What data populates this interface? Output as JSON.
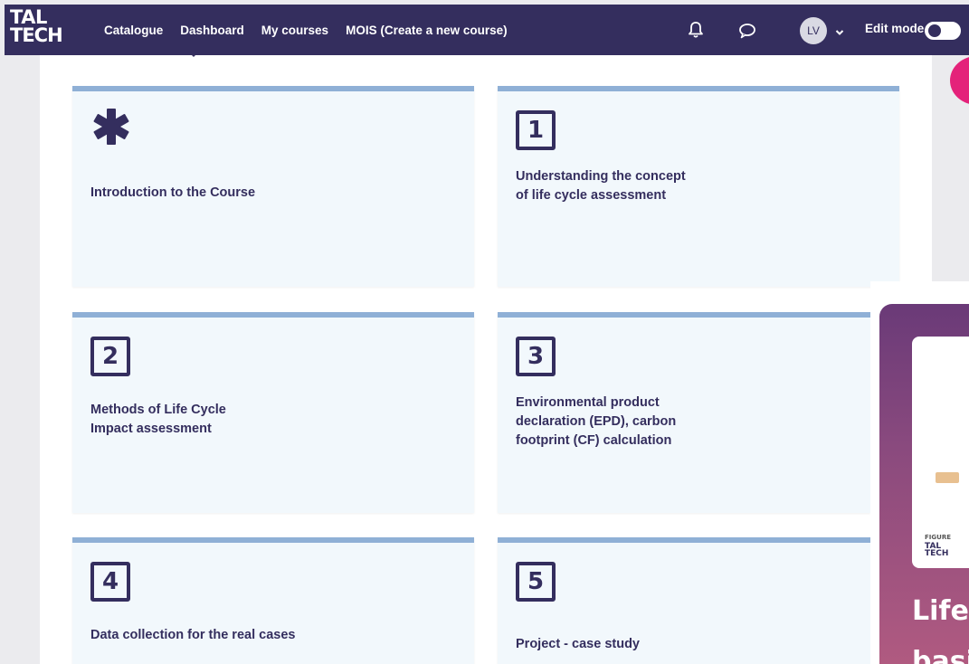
{
  "navbar": {
    "logo_line1": "TAL",
    "logo_line2": "TECH",
    "links": [
      "Catalogue",
      "Dashboard",
      "My courses",
      "MOIS (Create a new course)"
    ],
    "avatar_initials": "LV",
    "edit_mode_label": "Edit mode",
    "edit_mode_on": false,
    "icons": {
      "notifications": "bell-icon",
      "messages": "chat-icon",
      "user_menu": "chevron-down-icon"
    }
  },
  "sections": [
    {
      "badge": "",
      "icon": "asterisk-icon",
      "title": "Introduction to the Course"
    },
    {
      "badge": "1",
      "title": "Understanding the concept of life cycle assessment"
    },
    {
      "badge": "2",
      "title": "Methods of Life Cycle Impact assessment"
    },
    {
      "badge": "3",
      "title": "Environmental product declaration (EPD), carbon footprint (CF) calculation"
    },
    {
      "badge": "4",
      "title": "Data collection for the real cases"
    },
    {
      "badge": "5",
      "title": "Project - case study"
    }
  ],
  "promo": {
    "figure_label": "FIGURE",
    "logo_line1": "TAL",
    "logo_line2": "TECH",
    "title_line1": "Life",
    "title_line2": "basi"
  },
  "colors": {
    "navbar": "#342e5e",
    "card_bg": "#f2f8fc",
    "card_border": "#8fb0d6",
    "accent_pink": "#e4227a"
  }
}
